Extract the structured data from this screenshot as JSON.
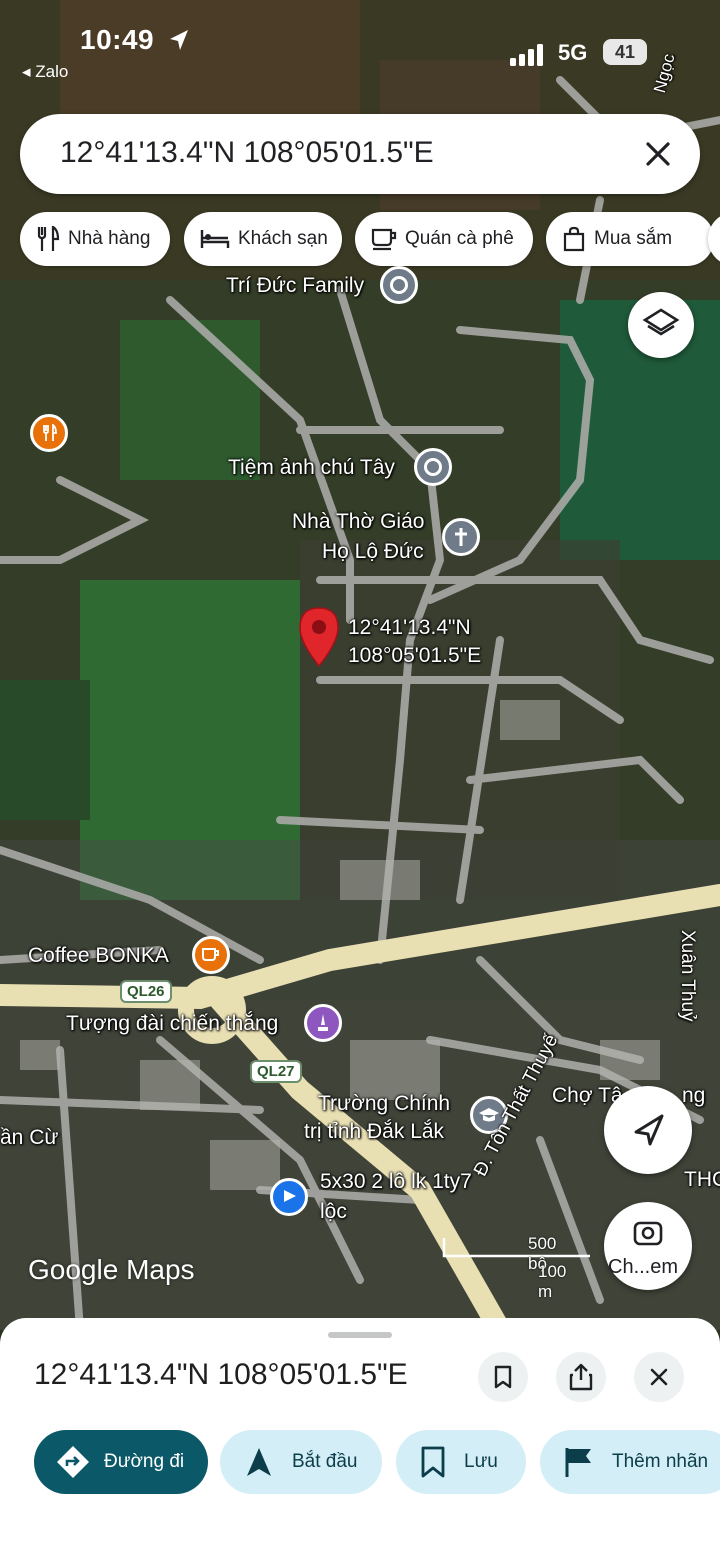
{
  "status_bar": {
    "time": "10:49",
    "back_app": "◂ Zalo",
    "network": "5G",
    "battery": "41"
  },
  "search": {
    "value": "12°41'13.4\"N 108°05'01.5\"E"
  },
  "chips": [
    {
      "label": "Nhà hàng",
      "icon": "restaurant-icon"
    },
    {
      "label": "Khách sạn",
      "icon": "hotel-icon"
    },
    {
      "label": "Quán cà phê",
      "icon": "coffee-icon"
    },
    {
      "label": "Mua sắm",
      "icon": "shopping-bag-icon"
    }
  ],
  "map": {
    "places": {
      "tri_duc_family": "Trí Đức Family",
      "tiem_anh": "Tiệm ảnh chú Tây",
      "nha_tho_1": "Nhà Thờ Giáo",
      "nha_tho_2": "Họ Lộ Đức",
      "coffee_bonka": "Coffee BONKA",
      "tuong_dai": "Tượng đài chiến thắng",
      "truong_chinh_tri_1": "Trường Chính",
      "truong_chinh_tri_2": "trị tỉnh Đắk Lắk",
      "cho": "Chợ Tâ",
      "cho_tail": "ng",
      "lot_1": "5x30 2 lô lk 1ty7",
      "lot_2": "lộc",
      "an_cu": "ần Cừ",
      "thc": "THC"
    },
    "pin": {
      "lat": "12°41'13.4\"N",
      "lng": "108°05'01.5\"E"
    },
    "roads": {
      "ql26": "QL26",
      "ql27": "QL27",
      "xuan_thuy": "Xuân Thuỷ",
      "ton_that_thuyet": "Đ. Tôn Thất Thuyế",
      "top_right": "Ngọc"
    },
    "attribution": "Google Maps",
    "scale": {
      "imperial": "500 bộ",
      "metric": "100 m"
    },
    "camera_label": "Ch...em"
  },
  "sheet": {
    "title": "12°41'13.4\"N 108°05'01.5\"E",
    "actions": [
      {
        "label": "Đường đi",
        "icon": "directions-icon"
      },
      {
        "label": "Bắt đầu",
        "icon": "navigation-arrow-icon"
      },
      {
        "label": "Lưu",
        "icon": "bookmark-icon"
      },
      {
        "label": "Thêm nhãn",
        "icon": "flag-icon"
      }
    ]
  },
  "colors": {
    "primary_action": "#0b5868",
    "secondary_action": "#d3eef7",
    "pin": "#e0252b",
    "highway": "#e8dfb3"
  }
}
